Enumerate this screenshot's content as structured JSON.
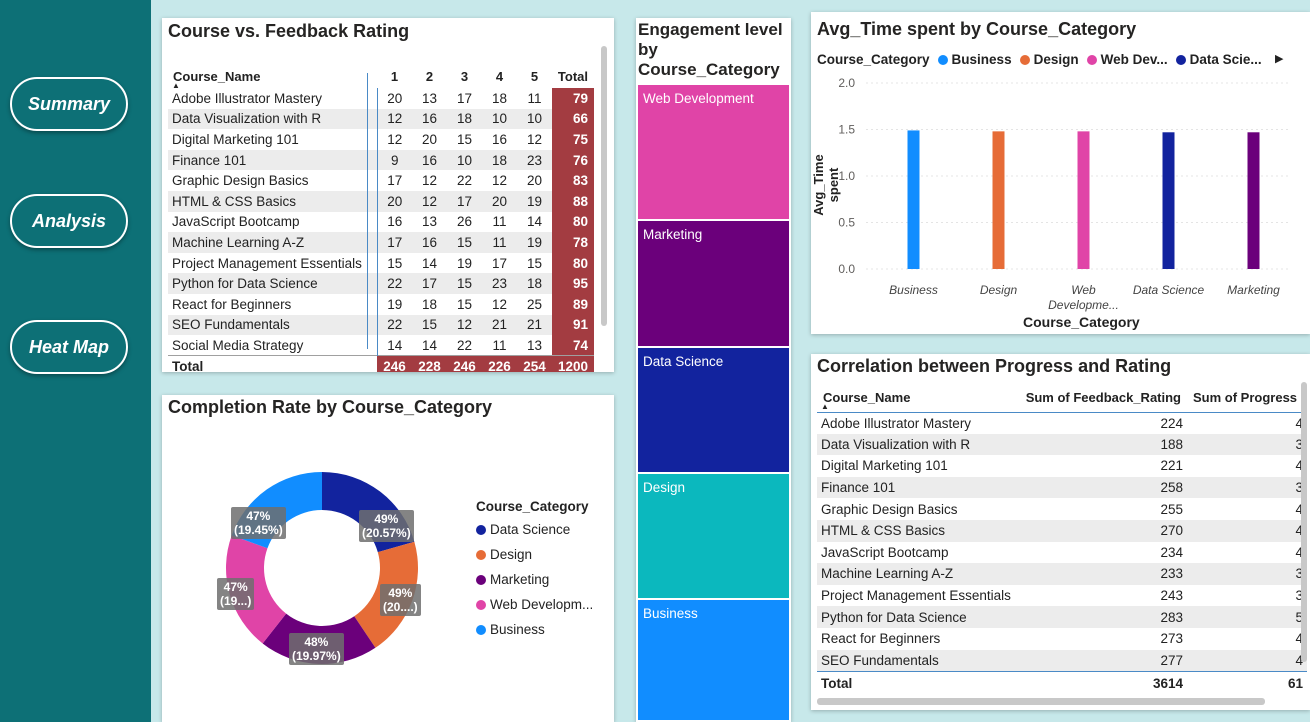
{
  "nav": {
    "summary": "Summary",
    "analysis": "Analysis",
    "heatmap": "Heat Map"
  },
  "matrix": {
    "title": "Course vs. Feedback Rating",
    "headers": [
      "Course_Name",
      "1",
      "2",
      "3",
      "4",
      "5",
      "Total"
    ],
    "rows": [
      {
        "name": "Adobe Illustrator Mastery",
        "v": [
          "20",
          "13",
          "17",
          "18",
          "11"
        ],
        "total": "79"
      },
      {
        "name": "Data Visualization with R",
        "v": [
          "12",
          "16",
          "18",
          "10",
          "10"
        ],
        "total": "66"
      },
      {
        "name": "Digital Marketing 101",
        "v": [
          "12",
          "20",
          "15",
          "16",
          "12"
        ],
        "total": "75"
      },
      {
        "name": "Finance 101",
        "v": [
          "9",
          "16",
          "10",
          "18",
          "23"
        ],
        "total": "76"
      },
      {
        "name": "Graphic Design Basics",
        "v": [
          "17",
          "12",
          "22",
          "12",
          "20"
        ],
        "total": "83"
      },
      {
        "name": "HTML & CSS Basics",
        "v": [
          "20",
          "12",
          "17",
          "20",
          "19"
        ],
        "total": "88"
      },
      {
        "name": "JavaScript Bootcamp",
        "v": [
          "16",
          "13",
          "26",
          "11",
          "14"
        ],
        "total": "80"
      },
      {
        "name": "Machine Learning A-Z",
        "v": [
          "17",
          "16",
          "15",
          "11",
          "19"
        ],
        "total": "78"
      },
      {
        "name": "Project Management Essentials",
        "v": [
          "15",
          "14",
          "19",
          "17",
          "15"
        ],
        "total": "80"
      },
      {
        "name": "Python for Data Science",
        "v": [
          "22",
          "17",
          "15",
          "23",
          "18"
        ],
        "total": "95"
      },
      {
        "name": "React for Beginners",
        "v": [
          "19",
          "18",
          "15",
          "12",
          "25"
        ],
        "total": "89"
      },
      {
        "name": "SEO Fundamentals",
        "v": [
          "22",
          "15",
          "12",
          "21",
          "21"
        ],
        "total": "91"
      },
      {
        "name": "Social Media Strategy",
        "v": [
          "14",
          "14",
          "22",
          "11",
          "13"
        ],
        "total": "74"
      }
    ],
    "total_row": {
      "name": "Total",
      "v": [
        "246",
        "228",
        "246",
        "226",
        "254"
      ],
      "total": "1200"
    }
  },
  "donut": {
    "title": "Completion Rate by Course_Category",
    "legend_title": "Course_Category",
    "legend": [
      "Data Science",
      "Design",
      "Marketing",
      "Web Developm...",
      "Business"
    ],
    "labels": [
      {
        "pct": "49%",
        "share": "(20.57%)"
      },
      {
        "pct": "49%",
        "share": "(20....)"
      },
      {
        "pct": "48%",
        "share": "(19.97%)"
      },
      {
        "pct": "47%",
        "share": "(19...)"
      },
      {
        "pct": "47%",
        "share": "(19.45%)"
      }
    ]
  },
  "treemap": {
    "title": "Engagement level by Course_Category",
    "tiles": [
      "Web Development",
      "Marketing",
      "Data Science",
      "Design",
      "Business"
    ]
  },
  "bar": {
    "title": "Avg_Time spent by Course_Category",
    "legend_title": "Course_Category",
    "legend": [
      "Business",
      "Design",
      "Web Dev...",
      "Data Scie..."
    ],
    "xlabel": "Course_Category",
    "ylabel": "Avg_Time spent",
    "tick_labels": [
      "Business",
      "Design",
      "Web Developme...",
      "Data Science",
      "Marketing"
    ]
  },
  "correlation": {
    "title": "Correlation between Progress and Rating",
    "headers": [
      "Course_Name",
      "Sum of Feedback_Rating",
      "Sum of Progress"
    ],
    "rows": [
      {
        "name": "Adobe Illustrator Mastery",
        "rating": "224",
        "prog": "4"
      },
      {
        "name": "Data Visualization with R",
        "rating": "188",
        "prog": "3"
      },
      {
        "name": "Digital Marketing 101",
        "rating": "221",
        "prog": "4"
      },
      {
        "name": "Finance 101",
        "rating": "258",
        "prog": "3"
      },
      {
        "name": "Graphic Design Basics",
        "rating": "255",
        "prog": "4"
      },
      {
        "name": "HTML & CSS Basics",
        "rating": "270",
        "prog": "4"
      },
      {
        "name": "JavaScript Bootcamp",
        "rating": "234",
        "prog": "4"
      },
      {
        "name": "Machine Learning A-Z",
        "rating": "233",
        "prog": "3"
      },
      {
        "name": "Project Management Essentials",
        "rating": "243",
        "prog": "3"
      },
      {
        "name": "Python for Data Science",
        "rating": "283",
        "prog": "5"
      },
      {
        "name": "React for Beginners",
        "rating": "273",
        "prog": "4"
      },
      {
        "name": "SEO Fundamentals",
        "rating": "277",
        "prog": "4"
      }
    ],
    "total": {
      "name": "Total",
      "rating": "3614",
      "prog": "61"
    }
  },
  "colors": {
    "data_science": "#12239e",
    "design": "#e66c37",
    "marketing": "#6b007b",
    "web_development": "#e044a7",
    "business": "#118dff",
    "teal_sidebar": "#0d7076",
    "matrix_total": "#a33c41"
  },
  "chart_data": [
    {
      "type": "pie",
      "title": "Completion Rate by Course_Category",
      "categories": [
        "Data Science",
        "Design",
        "Marketing",
        "Web Development",
        "Business"
      ],
      "values": [
        49,
        49,
        48,
        47,
        47
      ],
      "shares_pct": [
        20.57,
        20.0,
        19.97,
        19.9,
        19.45
      ],
      "legend": "right"
    },
    {
      "type": "bar",
      "title": "Avg_Time spent by Course_Category",
      "categories": [
        "Business",
        "Design",
        "Web Development",
        "Data Science",
        "Marketing"
      ],
      "values": [
        1.49,
        1.48,
        1.48,
        1.47,
        1.47
      ],
      "xlabel": "Course_Category",
      "ylabel": "Avg_Time spent",
      "ylim": [
        0,
        2.0
      ],
      "yticks": [
        0.0,
        0.5,
        1.0,
        1.5,
        2.0
      ],
      "legend": "top",
      "grid": true
    },
    {
      "type": "table",
      "title": "Engagement level by Course_Category",
      "categories": [
        "Web Development",
        "Marketing",
        "Data Science",
        "Design",
        "Business"
      ],
      "values": [
        1,
        1,
        1,
        1,
        1
      ]
    }
  ]
}
